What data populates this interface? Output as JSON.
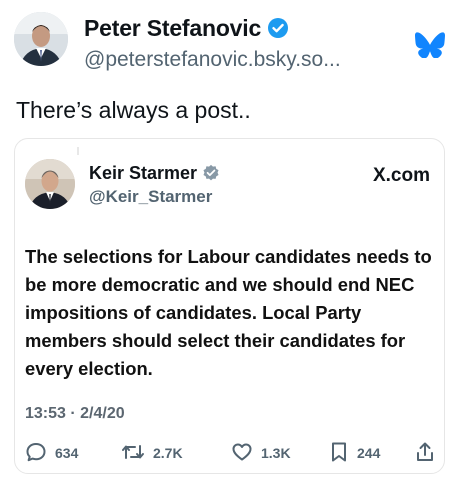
{
  "post": {
    "author_name": "Peter Stefanovic",
    "author_handle": "@peterstefanovic.bsky.so...",
    "text": "There’s always a post.."
  },
  "embed": {
    "author_name": "Keir Starmer",
    "author_handle": "@Keir_Starmer",
    "source": "X.com",
    "body": "The selections for Labour candidates needs to be more democratic and we should end NEC impositions of candidates. Local Party members should select their candidates for every election.",
    "timestamp": "13:53 · 2/4/20",
    "stats": {
      "replies": "634",
      "reposts": "2.7K",
      "likes": "1.3K",
      "bookmarks": "244"
    }
  },
  "colors": {
    "bluesky": "#1185fe",
    "verified": "#1d9bf0",
    "x_verified": "#8899a6",
    "muted": "#536471"
  },
  "icons": [
    "verified-badge-icon",
    "bluesky-butterfly-icon",
    "reply-icon",
    "repost-icon",
    "like-icon",
    "bookmark-icon",
    "share-icon"
  ]
}
